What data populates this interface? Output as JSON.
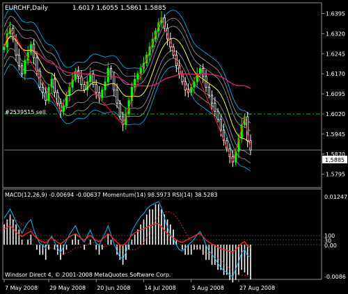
{
  "chart_data": [
    {
      "type": "candlestick",
      "symbol_label": "EURCHF,Daily",
      "ohlc_label": "1.6017 1.6055 1.5861 1.5885",
      "annotation": "#2539515 sell",
      "current_price_label": "1.5885",
      "current_price": 1.5885,
      "sell_level": 1.602,
      "ylim": [
        1.575,
        1.643
      ],
      "y_ticks": [
        "1.6395",
        "1.6320",
        "1.6245",
        "1.6170",
        "1.6095",
        "1.6020",
        "1.5945",
        "1.5870",
        "1.5795"
      ],
      "x_ticks": [
        "7 May 2008",
        "29 May 2008",
        "20 Jun 2008",
        "14 Jul 2008",
        "5 Aug 2008",
        "27 Aug 2008"
      ],
      "colors": {
        "up": "#00ff00",
        "down": "#ffffff",
        "ma_long": "#dc1e6e",
        "ma_mid": "#ffff00",
        "band_outer": "#00bfff",
        "band_grey": "#a0a0a0",
        "zigzag": "#ff2020",
        "sell_line": "#00c000"
      },
      "close_path": [
        1.627,
        1.632,
        1.634,
        1.63,
        1.624,
        1.62,
        1.617,
        1.622,
        1.625,
        1.628,
        1.623,
        1.618,
        1.612,
        1.61,
        1.607,
        1.612,
        1.615,
        1.61,
        1.606,
        1.603,
        1.605,
        1.609,
        1.612,
        1.615,
        1.618,
        1.616,
        1.613,
        1.611,
        1.614,
        1.617,
        1.613,
        1.61,
        1.608,
        1.611,
        1.614,
        1.619,
        1.616,
        1.611,
        1.606,
        1.601,
        1.598,
        1.602,
        1.607,
        1.612,
        1.615,
        1.617,
        1.619,
        1.621,
        1.624,
        1.627,
        1.63,
        1.633,
        1.636,
        1.638,
        1.634,
        1.63,
        1.627,
        1.624,
        1.62,
        1.617,
        1.614,
        1.611,
        1.61,
        1.612,
        1.614,
        1.617,
        1.619,
        1.616,
        1.612,
        1.609,
        1.606,
        1.603,
        1.6,
        1.596,
        1.592,
        1.589,
        1.586,
        1.584,
        1.588,
        1.593,
        1.598,
        1.601,
        1.592,
        1.5885
      ]
    },
    {
      "type": "line",
      "header": "MACD(12,26,9) -0.00694 -0.00637  Momentum(14) 98.5973  RSI(14) 38.5283",
      "right_labels": [
        "0.01247",
        "100",
        "0.00",
        "-0.0086"
      ],
      "left_mark": "30",
      "series": [
        {
          "name": "MACD(12,26,9)",
          "color": "#ffffff",
          "values": [
            0.004,
            0.005,
            0.006,
            0.005,
            0.004,
            0.003,
            0.001,
            0.0,
            0.001,
            0.002,
            0.0,
            -0.001,
            -0.002,
            -0.002,
            -0.003,
            -0.001,
            0.0,
            -0.001,
            -0.002,
            -0.003,
            -0.002,
            -0.001,
            0.0,
            0.001,
            0.002,
            0.001,
            0.0,
            -0.001,
            0.0,
            0.001,
            0.0,
            -0.001,
            -0.002,
            -0.001,
            0.0,
            0.002,
            0.001,
            0.0,
            -0.002,
            -0.003,
            -0.004,
            -0.003,
            -0.001,
            0.001,
            0.002,
            0.003,
            0.004,
            0.005,
            0.006,
            0.007,
            0.007,
            0.008,
            0.008,
            0.007,
            0.006,
            0.005,
            0.004,
            0.003,
            0.001,
            0.0,
            -0.001,
            -0.002,
            -0.002,
            -0.002,
            -0.001,
            -0.001,
            -0.001,
            -0.002,
            -0.003,
            -0.003,
            -0.004,
            -0.004,
            -0.005,
            -0.005,
            -0.006,
            -0.006,
            -0.007,
            -0.0075,
            -0.007,
            -0.006,
            -0.005,
            -0.0055,
            -0.006,
            -0.0069
          ]
        },
        {
          "name": "Momentum(14)",
          "color": "#00bfff",
          "values": [
            101.2,
            101.5,
            101.8,
            101.4,
            100.9,
            100.6,
            100.2,
            100.6,
            100.9,
            101.1,
            100.4,
            99.9,
            99.5,
            99.4,
            99.2,
            99.7,
            100.0,
            99.6,
            99.2,
            98.9,
            99.3,
            99.7,
            100.1,
            100.4,
            100.7,
            100.2,
            99.8,
            99.6,
            100.0,
            100.4,
            99.9,
            99.5,
            99.4,
            99.8,
            100.2,
            100.7,
            100.1,
            99.5,
            99.0,
            98.6,
            98.5,
            98.9,
            99.6,
            100.3,
            100.7,
            101.0,
            101.3,
            101.5,
            101.8,
            102.0,
            102.1,
            102.2,
            102.3,
            101.9,
            101.2,
            100.6,
            100.1,
            99.8,
            99.4,
            99.1,
            99.0,
            99.2,
            99.4,
            99.6,
            99.8,
            100.1,
            100.3,
            99.9,
            99.4,
            99.0,
            98.8,
            98.5,
            98.2,
            97.9,
            97.7,
            97.6,
            97.4,
            97.3,
            97.8,
            98.3,
            98.9,
            99.1,
            98.7,
            98.6
          ]
        },
        {
          "name": "RSI(14)",
          "color": "#ff2020",
          "values": [
            62,
            64,
            66,
            63,
            58,
            55,
            52,
            55,
            57,
            59,
            54,
            50,
            47,
            46,
            44,
            48,
            51,
            48,
            45,
            43,
            46,
            49,
            52,
            54,
            56,
            53,
            50,
            48,
            51,
            54,
            50,
            47,
            46,
            49,
            52,
            56,
            53,
            49,
            45,
            42,
            41,
            44,
            49,
            54,
            57,
            59,
            61,
            62,
            64,
            66,
            67,
            68,
            69,
            65,
            60,
            56,
            53,
            51,
            48,
            46,
            45,
            47,
            49,
            51,
            53,
            55,
            56,
            52,
            48,
            45,
            43,
            41,
            39,
            37,
            36,
            35,
            34,
            33,
            36,
            40,
            44,
            46,
            40,
            38.5
          ]
        }
      ]
    }
  ],
  "footer": "Windsor Direct 4, © 2001-2008 MetaQuotes Software Corp."
}
